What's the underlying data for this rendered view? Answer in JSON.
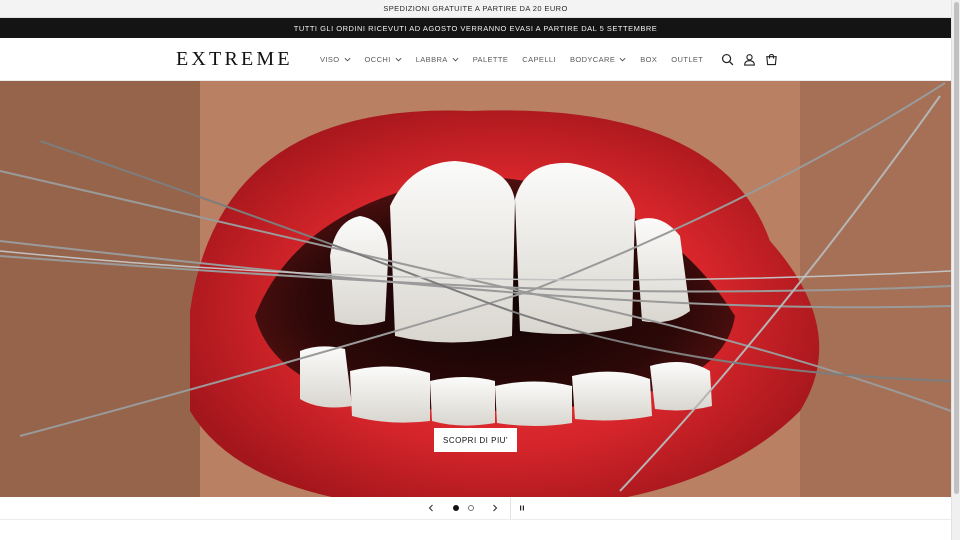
{
  "announcements": {
    "top": "SPEDIZIONI GRATUITE A PARTIRE DA 20 EURO",
    "secondary": "TUTTI GLI ORDINI RICEVUTI AD AGOSTO VERRANNO EVASI A PARTIRE DAL 5 SETTEMBRE"
  },
  "header": {
    "logo": "EXTREME",
    "nav": [
      {
        "label": "VISO",
        "has_dropdown": true
      },
      {
        "label": "OCCHI",
        "has_dropdown": true
      },
      {
        "label": "LABBRA",
        "has_dropdown": true
      },
      {
        "label": "PALETTE",
        "has_dropdown": false
      },
      {
        "label": "CAPELLI",
        "has_dropdown": false
      },
      {
        "label": "BODYCARE",
        "has_dropdown": true
      },
      {
        "label": "BOX",
        "has_dropdown": false
      },
      {
        "label": "OUTLET",
        "has_dropdown": false
      }
    ],
    "icons": [
      "search-icon",
      "account-icon",
      "cart-icon"
    ]
  },
  "hero": {
    "image": "close-up-red-lips-with-wires",
    "cta_label": "SCOPRI DI PIU'"
  },
  "slider": {
    "slide_count": 2,
    "active_slide": 1,
    "icons": [
      "chevron-left-icon",
      "chevron-right-icon",
      "pause-icon"
    ]
  },
  "colors": {
    "announcement_bar": "#141414",
    "lipstick_red": "#d7262b",
    "cta_bg": "#ffffff"
  }
}
